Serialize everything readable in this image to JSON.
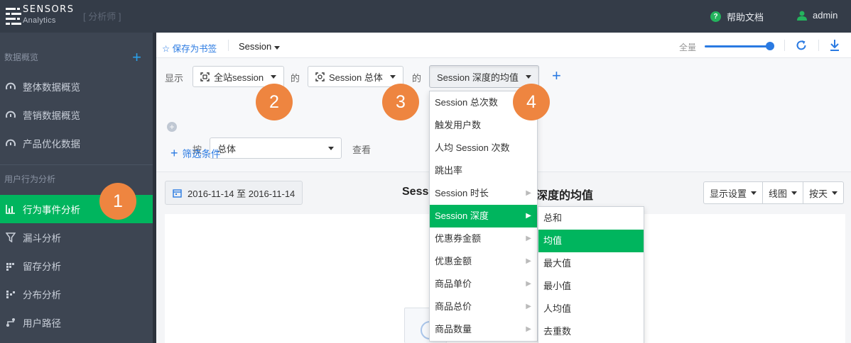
{
  "header": {
    "logo_main": "SENSORS",
    "logo_sub": "Analytics",
    "role": "[ 分析师 ]",
    "help": "帮助文档",
    "help_icon": "?",
    "user": "admin"
  },
  "sidebar": {
    "sections": [
      {
        "label": "数据概览",
        "plus": "+"
      },
      {
        "label": "用户行为分析"
      }
    ],
    "items": [
      {
        "label": "整体数据概览",
        "icon": "dashboard-icon"
      },
      {
        "label": "营销数据概览",
        "icon": "dashboard-icon"
      },
      {
        "label": "产品优化数据",
        "icon": "dashboard-icon"
      },
      {
        "label": "行为事件分析",
        "icon": "bar-chart-icon",
        "active": true
      },
      {
        "label": "漏斗分析",
        "icon": "funnel-icon"
      },
      {
        "label": "留存分析",
        "icon": "retention-icon"
      },
      {
        "label": "分布分析",
        "icon": "distribution-icon"
      },
      {
        "label": "用户路径",
        "icon": "path-icon"
      }
    ]
  },
  "toolbar": {
    "bookmark": "☆ 保存为书签",
    "session_label": "Session",
    "full_label": "全量",
    "slider_value": 1.0
  },
  "query": {
    "show_label": "显示",
    "of_label_1": "的",
    "of_label_2": "的",
    "entity": "全站session",
    "scope": "Session 总体",
    "metric": "Session 深度的均值",
    "add": "+",
    "add_circle": "+",
    "by_label": "按",
    "group_by": "总体",
    "view_label": "查看",
    "filter": "筛选条件",
    "filter_plus": "+"
  },
  "report": {
    "date_range": "2016-11-14 至 2016-11-14",
    "title_left": "Sessi",
    "title_right": "深度的均值",
    "display_settings": "显示设置",
    "chart_type": "线图",
    "granularity": "按天"
  },
  "metric_menu": [
    {
      "label": "Session 总次数",
      "submenu": false
    },
    {
      "label": "触发用户数",
      "submenu": false
    },
    {
      "label": "人均 Session 次数",
      "submenu": false
    },
    {
      "label": "跳出率",
      "submenu": false
    },
    {
      "label": "Session 时长",
      "submenu": true
    },
    {
      "label": "Session 深度",
      "submenu": true,
      "active": true
    },
    {
      "label": "优惠券金额",
      "submenu": true
    },
    {
      "label": "优惠金额",
      "submenu": true
    },
    {
      "label": "商品单价",
      "submenu": true
    },
    {
      "label": "商品总价",
      "submenu": true
    },
    {
      "label": "商品数量",
      "submenu": true
    }
  ],
  "agg_menu": [
    {
      "label": "总和"
    },
    {
      "label": "均值",
      "active": true
    },
    {
      "label": "最大值"
    },
    {
      "label": "最小值"
    },
    {
      "label": "人均值"
    },
    {
      "label": "去重数"
    }
  ],
  "badges": [
    "1",
    "2",
    "3",
    "4"
  ],
  "colors": {
    "topbar": "#343c48",
    "sidebar": "#3d4552",
    "active_green": "#00b55e",
    "link_blue": "#2a7ae2",
    "badge_orange": "#ee8540"
  }
}
